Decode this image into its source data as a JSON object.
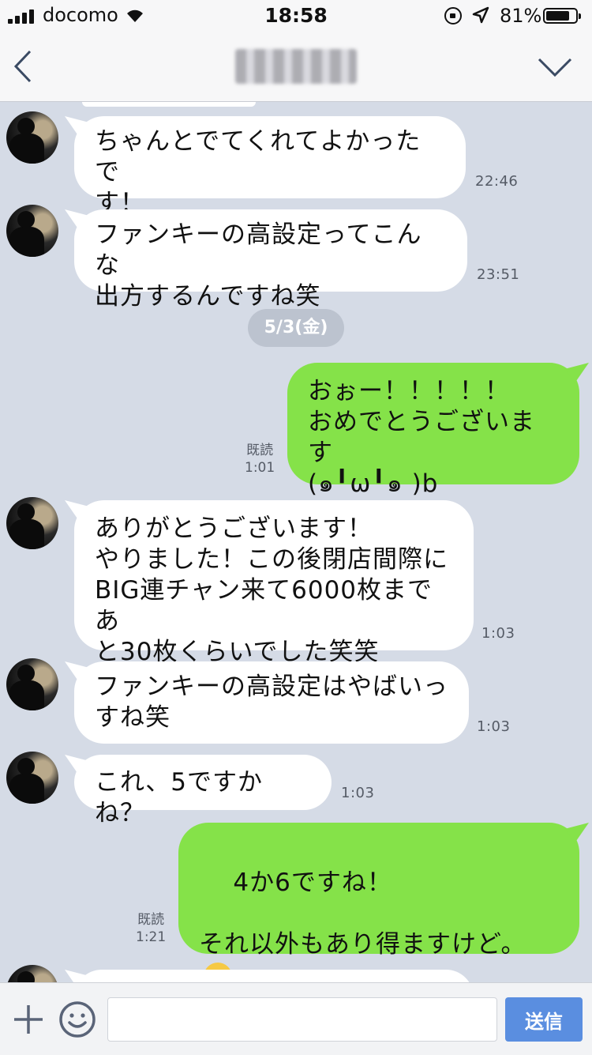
{
  "status": {
    "carrier": "docomo",
    "time": "18:58",
    "battery": "81%",
    "battery_level": 0.81
  },
  "header": {
    "back_icon": "chevron-left-icon",
    "menu_icon": "chevron-down-icon"
  },
  "date_separator": "5/3(金)",
  "messages": [
    {
      "from": "them",
      "text": "ちゃんとでてくれてよかったで\nす！",
      "time": "22:46"
    },
    {
      "from": "them",
      "text": "ファンキーの高設定ってこんな\n出方するんですね笑",
      "time": "23:51"
    },
    {
      "from": "me",
      "text": "おぉー！！！！！\nおめでとうございます\n(๑╹ω╹๑ )b",
      "time": "1:01",
      "read": "既読"
    },
    {
      "from": "them",
      "text": "ありがとうございます！\nやりました！この後閉店間際に\nBIG連チャン来て6000枚まであ\nと30枚くらいでした笑笑",
      "time": "1:03"
    },
    {
      "from": "them",
      "text": "ファンキーの高設定はやばいっ\nすね笑",
      "time": "1:03"
    },
    {
      "from": "them",
      "text": "これ、5ですかね？",
      "time": "1:03"
    },
    {
      "from": "me",
      "text": "4か6ですね！\n\nそれ以外もあり得ますけど。",
      "time": "1:21",
      "read": "既読",
      "emoji": "screaming-face-icon"
    }
  ],
  "input": {
    "placeholder": "",
    "send_label": "送信"
  },
  "colors": {
    "chat_bg": "#d5dbe6",
    "my_bubble": "#85e249",
    "their_bubble": "#ffffff",
    "send_button": "#5a8ee0"
  }
}
